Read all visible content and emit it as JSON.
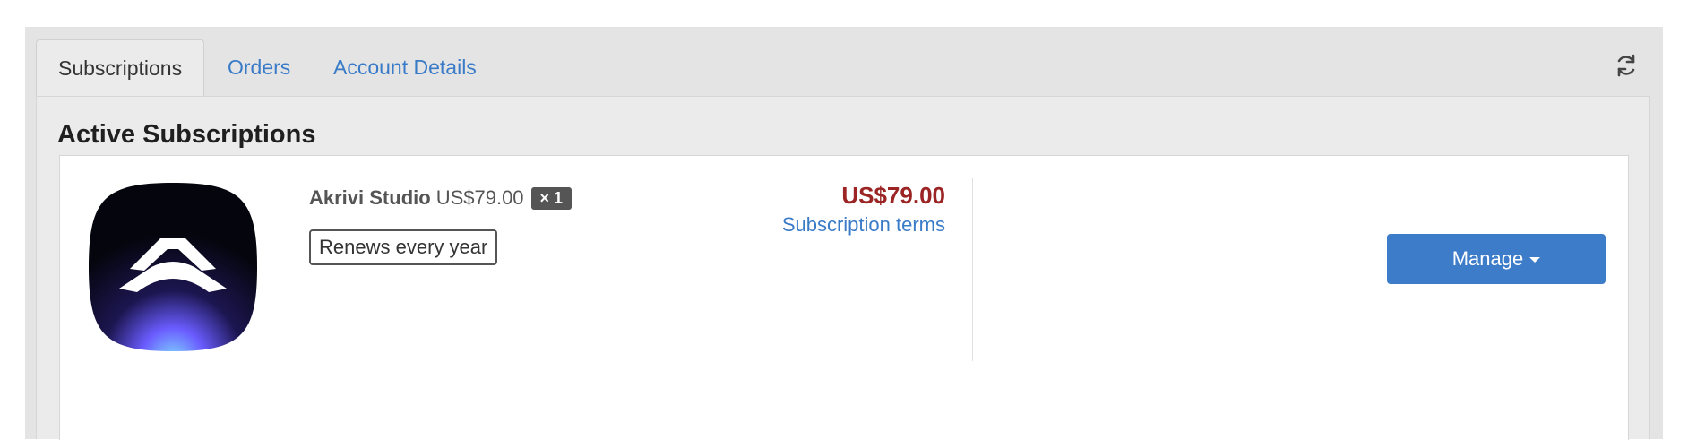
{
  "tabs": [
    {
      "label": "Subscriptions",
      "active": true
    },
    {
      "label": "Orders",
      "active": false
    },
    {
      "label": "Account Details",
      "active": false
    }
  ],
  "toolbar": {
    "refresh_icon": "refresh-icon"
  },
  "section": {
    "title": "Active Subscriptions"
  },
  "subscription": {
    "icon": "akrivi-studio-app-icon",
    "product_name": "Akrivi Studio",
    "unit_price": "US$79.00",
    "quantity_badge": "× 1",
    "renewal_badge": "Renews every year",
    "total_price": "US$79.00",
    "terms_link": "Subscription terms",
    "manage_label": "Manage",
    "manage_icon": "caret-down-icon"
  },
  "colors": {
    "link": "#3a7bc8",
    "price": "#9b2424",
    "button": "#3d7cc9",
    "badge": "#555555"
  }
}
